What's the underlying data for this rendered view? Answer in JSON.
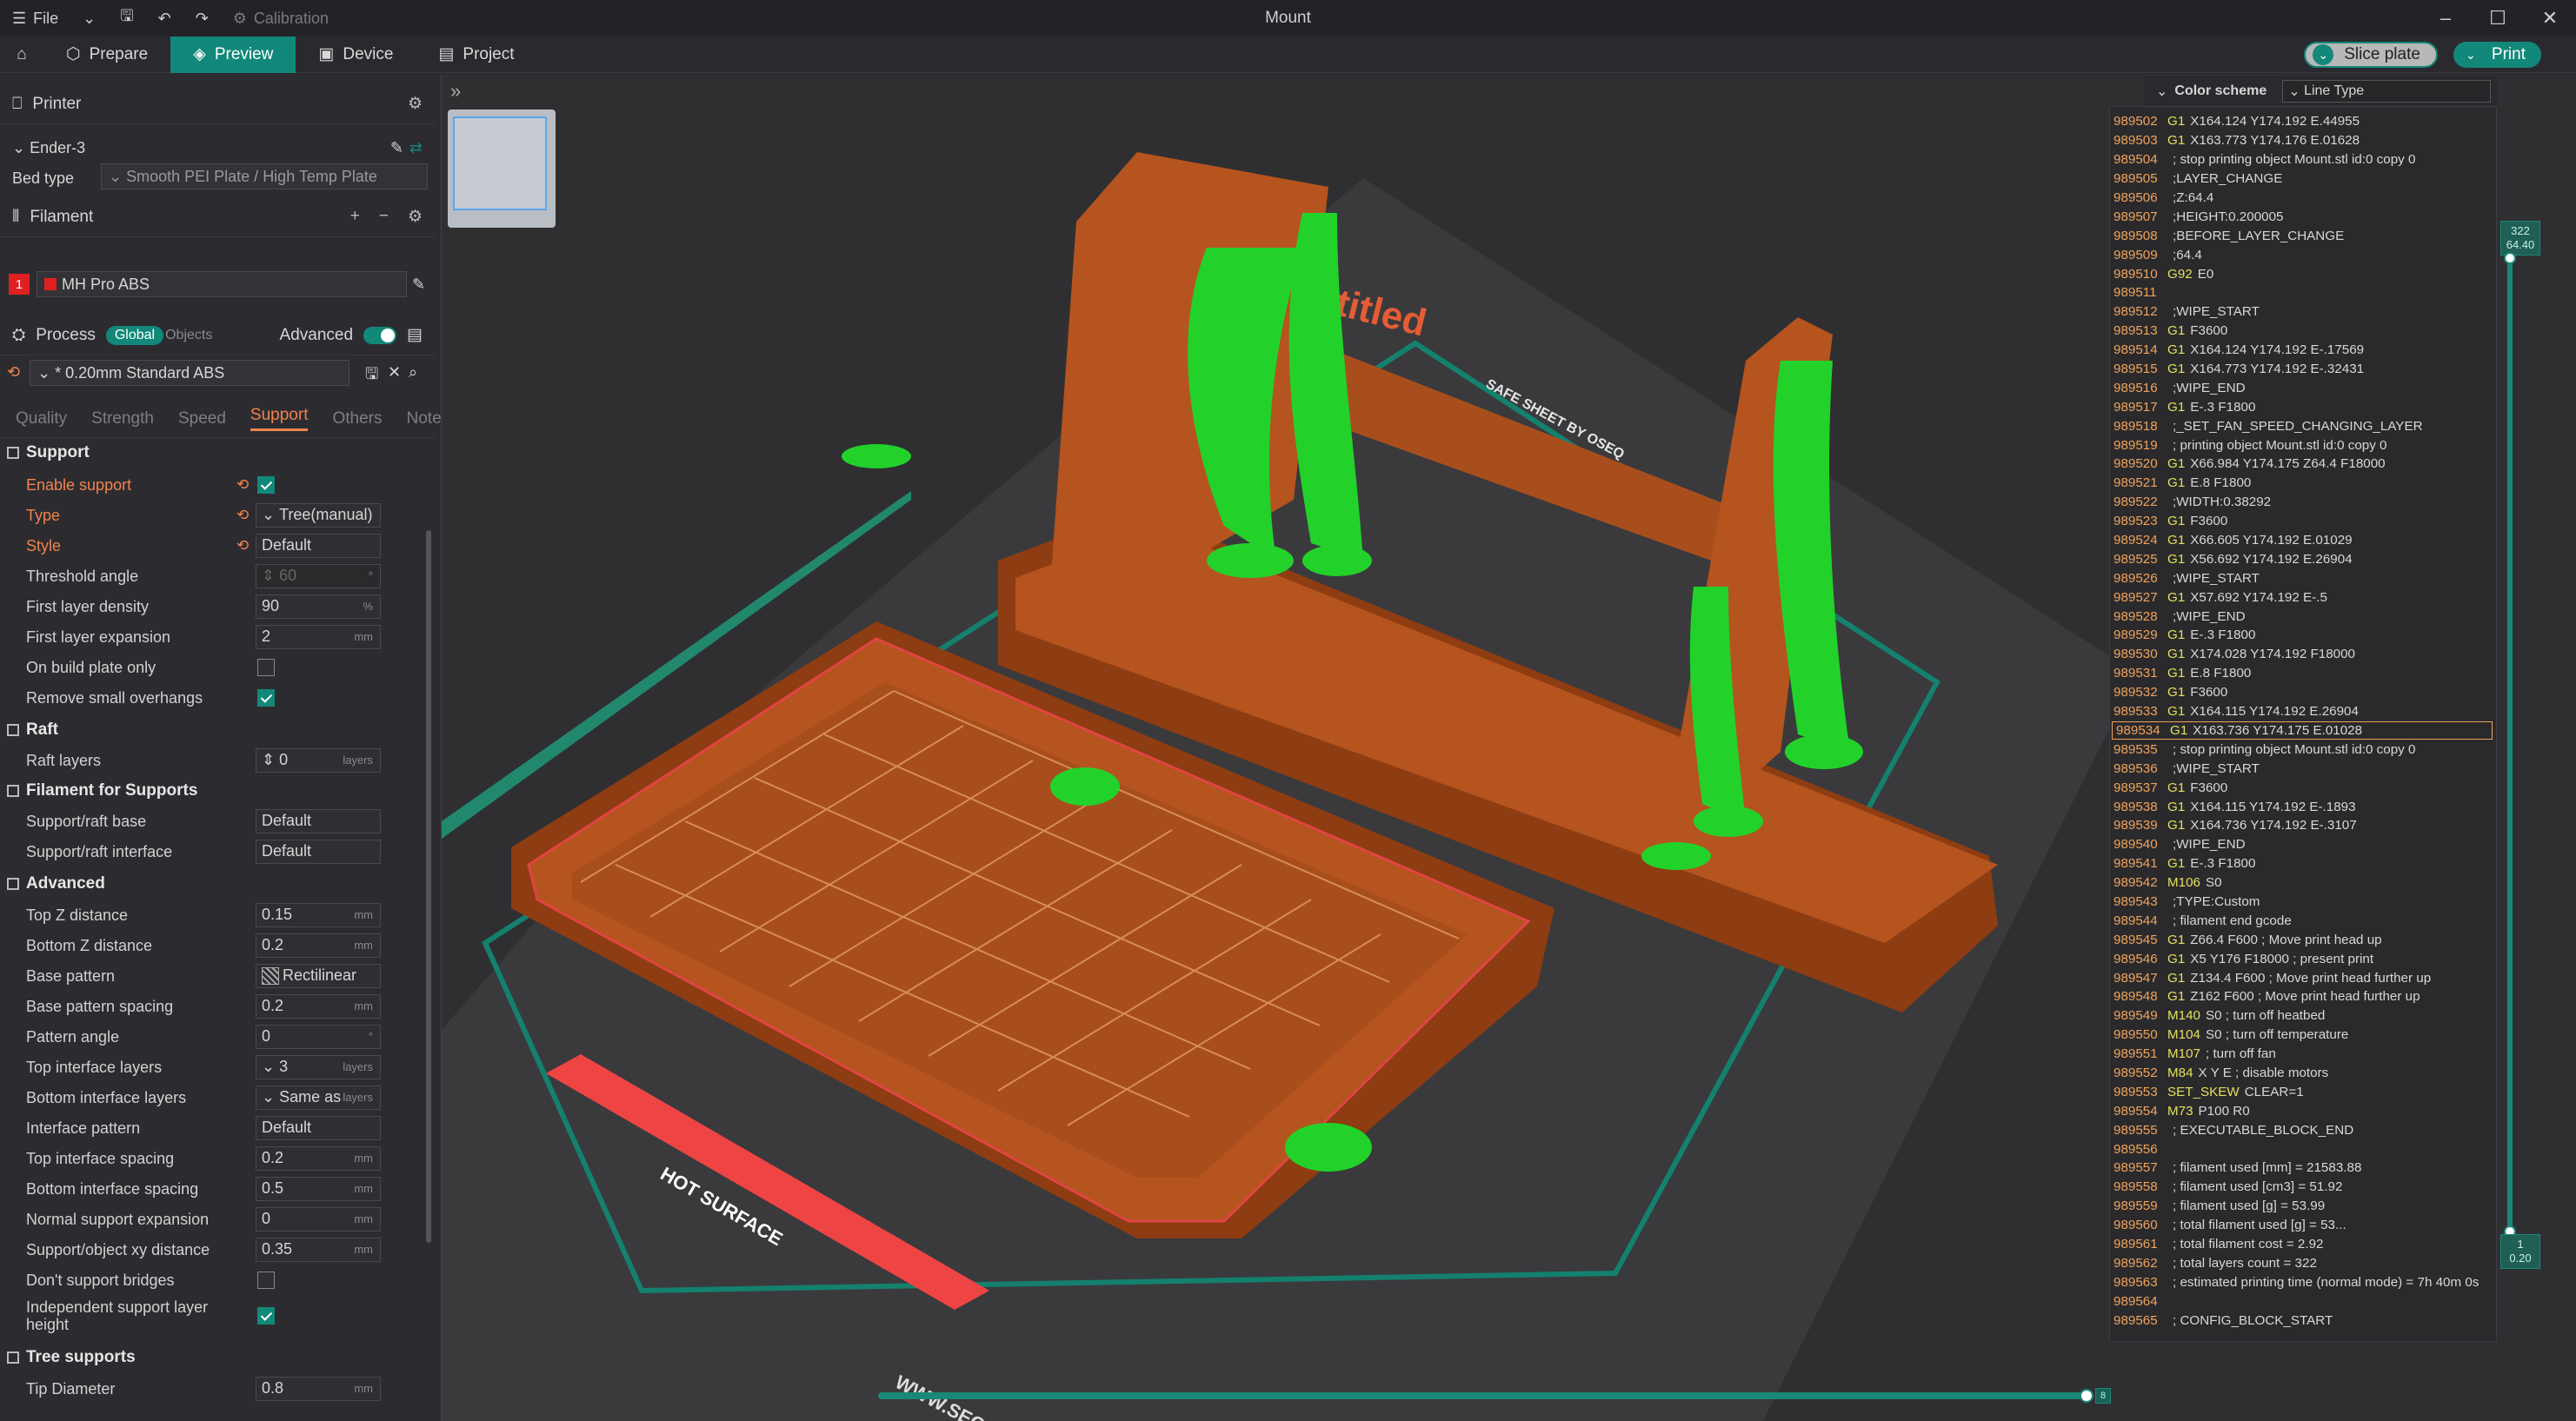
{
  "window": {
    "title": "Mount",
    "menu_file": "File",
    "calibration": "Calibration"
  },
  "tabs": {
    "prepare": "Prepare",
    "preview": "Preview",
    "device": "Device",
    "project": "Project"
  },
  "actions": {
    "slice": "Slice plate",
    "print": "Print"
  },
  "printer": {
    "section": "Printer",
    "name": "Ender-3",
    "bed_label": "Bed type",
    "bed_value": "Smooth PEI Plate / High Temp Plate"
  },
  "filament": {
    "section": "Filament",
    "index": "1",
    "name": "MH Pro ABS"
  },
  "process": {
    "section": "Process",
    "global": "Global",
    "objects": "Objects",
    "advanced": "Advanced",
    "preset": "* 0.20mm Standard ABS"
  },
  "subtabs": [
    "Quality",
    "Strength",
    "Speed",
    "Support",
    "Others",
    "Notes"
  ],
  "groups": {
    "support": "Support",
    "raft": "Raft",
    "filament_support": "Filament for Supports",
    "advanced": "Advanced",
    "tree": "Tree supports"
  },
  "settings": {
    "enable_support": "Enable support",
    "type": "Type",
    "type_val": "Tree(manual)",
    "style": "Style",
    "style_val": "Default",
    "threshold": "Threshold angle",
    "threshold_val": "60",
    "fl_density": "First layer density",
    "fl_density_val": "90",
    "unit_pct": "%",
    "fl_expansion": "First layer expansion",
    "fl_expansion_val": "2",
    "unit_mm": "mm",
    "on_build_plate": "On build plate only",
    "remove_small": "Remove small overhangs",
    "raft_layers": "Raft layers",
    "raft_layers_val": "0",
    "unit_layers": "layers",
    "raft_base": "Support/raft base",
    "raft_base_val": "Default",
    "raft_interface": "Support/raft interface",
    "raft_interface_val": "Default",
    "top_z": "Top Z distance",
    "top_z_val": "0.15",
    "bottom_z": "Bottom Z distance",
    "bottom_z_val": "0.2",
    "base_pattern": "Base pattern",
    "base_pattern_val": "Rectilinear",
    "base_spacing": "Base pattern spacing",
    "base_spacing_val": "0.2",
    "pattern_angle": "Pattern angle",
    "pattern_angle_val": "0",
    "unit_deg": "°",
    "top_iface_layers": "Top interface layers",
    "top_iface_layers_val": "3",
    "bottom_iface_layers": "Bottom interface layers",
    "bottom_iface_layers_val": "Same as",
    "iface_pattern": "Interface pattern",
    "iface_pattern_val": "Default",
    "top_iface_spacing": "Top interface spacing",
    "top_iface_spacing_val": "0.2",
    "bottom_iface_spacing": "Bottom interface spacing",
    "bottom_iface_spacing_val": "0.5",
    "normal_expansion": "Normal support expansion",
    "normal_expansion_val": "0",
    "xy_distance": "Support/object xy distance",
    "xy_distance_val": "0.35",
    "dont_bridges": "Don't support bridges",
    "indep_height": "Independent support layer height",
    "tip_diameter": "Tip Diameter",
    "tip_diameter_val": "0.8"
  },
  "color_scheme": {
    "label": "Color scheme",
    "value": "Line Type"
  },
  "plate": {
    "brand": "SAFE SHEET BY OSEQ",
    "title_partial": "ntitled",
    "hot": "HOT SURFACE",
    "url_partial": "WWW.SEQ"
  },
  "layer_slider": {
    "top_layer": "322",
    "top_height": "64.40",
    "bottom_layer": "1",
    "bottom_height": "0.20",
    "move_value": "8"
  },
  "gcode": [
    [
      "989502",
      "G1",
      "X164.124 Y174.192 E.44955"
    ],
    [
      "989503",
      "G1",
      "X163.773 Y174.176 E.01628"
    ],
    [
      "989504",
      "",
      "; stop printing object Mount.stl id:0 copy 0"
    ],
    [
      "989505",
      "",
      ";LAYER_CHANGE"
    ],
    [
      "989506",
      "",
      ";Z:64.4"
    ],
    [
      "989507",
      "",
      ";HEIGHT:0.200005"
    ],
    [
      "989508",
      "",
      ";BEFORE_LAYER_CHANGE"
    ],
    [
      "989509",
      "",
      ";64.4"
    ],
    [
      "989510",
      "G92",
      "E0"
    ],
    [
      "989511",
      "",
      ""
    ],
    [
      "989512",
      "",
      ";WIPE_START"
    ],
    [
      "989513",
      "G1",
      "F3600"
    ],
    [
      "989514",
      "G1",
      "X164.124 Y174.192 E-.17569"
    ],
    [
      "989515",
      "G1",
      "X164.773 Y174.192 E-.32431"
    ],
    [
      "989516",
      "",
      ";WIPE_END"
    ],
    [
      "989517",
      "G1",
      "E-.3 F1800"
    ],
    [
      "989518",
      "",
      ";_SET_FAN_SPEED_CHANGING_LAYER"
    ],
    [
      "989519",
      "",
      "; printing object Mount.stl id:0 copy 0"
    ],
    [
      "989520",
      "G1",
      "X66.984 Y174.175 Z64.4 F18000"
    ],
    [
      "989521",
      "G1",
      "E.8 F1800"
    ],
    [
      "989522",
      "",
      ";WIDTH:0.38292"
    ],
    [
      "989523",
      "G1",
      "F3600"
    ],
    [
      "989524",
      "G1",
      "X66.605 Y174.192 E.01029"
    ],
    [
      "989525",
      "G1",
      "X56.692 Y174.192 E.26904"
    ],
    [
      "989526",
      "",
      ";WIPE_START"
    ],
    [
      "989527",
      "G1",
      "X57.692 Y174.192 E-.5"
    ],
    [
      "989528",
      "",
      ";WIPE_END"
    ],
    [
      "989529",
      "G1",
      "E-.3 F1800"
    ],
    [
      "989530",
      "G1",
      "X174.028 Y174.192 F18000"
    ],
    [
      "989531",
      "G1",
      "E.8 F1800"
    ],
    [
      "989532",
      "G1",
      "F3600"
    ],
    [
      "989533",
      "G1",
      "X164.115 Y174.192 E.26904"
    ],
    [
      "989534",
      "G1",
      "X163.736 Y174.175 E.01028"
    ],
    [
      "989535",
      "",
      "; stop printing object Mount.stl id:0 copy 0"
    ],
    [
      "989536",
      "",
      ";WIPE_START"
    ],
    [
      "989537",
      "G1",
      "F3600"
    ],
    [
      "989538",
      "G1",
      "X164.115 Y174.192 E-.1893"
    ],
    [
      "989539",
      "G1",
      "X164.736 Y174.192 E-.3107"
    ],
    [
      "989540",
      "",
      ";WIPE_END"
    ],
    [
      "989541",
      "G1",
      "E-.3 F1800"
    ],
    [
      "989542",
      "M106",
      "S0"
    ],
    [
      "989543",
      "",
      ";TYPE:Custom"
    ],
    [
      "989544",
      "",
      "; filament end gcode"
    ],
    [
      "989545",
      "G1",
      "Z66.4 F600 ; Move print head up"
    ],
    [
      "989546",
      "G1",
      "X5 Y176 F18000 ; present print"
    ],
    [
      "989547",
      "G1",
      "Z134.4 F600 ; Move print head further up"
    ],
    [
      "989548",
      "G1",
      "Z162 F600 ; Move print head further up"
    ],
    [
      "989549",
      "M140",
      "S0 ; turn off heatbed"
    ],
    [
      "989550",
      "M104",
      "S0 ; turn off temperature"
    ],
    [
      "989551",
      "M107",
      "; turn off fan"
    ],
    [
      "989552",
      "M84",
      "X Y E ; disable motors"
    ],
    [
      "989553",
      "SET_SKEW",
      "CLEAR=1"
    ],
    [
      "989554",
      "M73",
      "P100 R0"
    ],
    [
      "989555",
      "",
      "; EXECUTABLE_BLOCK_END"
    ],
    [
      "989556",
      "",
      ""
    ],
    [
      "989557",
      "",
      "; filament used [mm] = 21583.88"
    ],
    [
      "989558",
      "",
      "; filament used [cm3] = 51.92"
    ],
    [
      "989559",
      "",
      "; filament used [g] = 53.99"
    ],
    [
      "989560",
      "",
      "; total filament used [g] = 53..."
    ],
    [
      "989561",
      "",
      "; total filament cost = 2.92"
    ],
    [
      "989562",
      "",
      "; total layers count = 322"
    ],
    [
      "989563",
      "",
      "; estimated printing time (normal mode) = 7h 40m 0s"
    ],
    [
      "989564",
      "",
      ""
    ],
    [
      "989565",
      "",
      "; CONFIG_BLOCK_START"
    ]
  ],
  "gcode_highlight_index": 32,
  "colors": {
    "accent": "#12887a",
    "orange": "#f0834f",
    "model": "#b5541e",
    "support": "#22d22a",
    "plate": "#3a3a3d"
  }
}
